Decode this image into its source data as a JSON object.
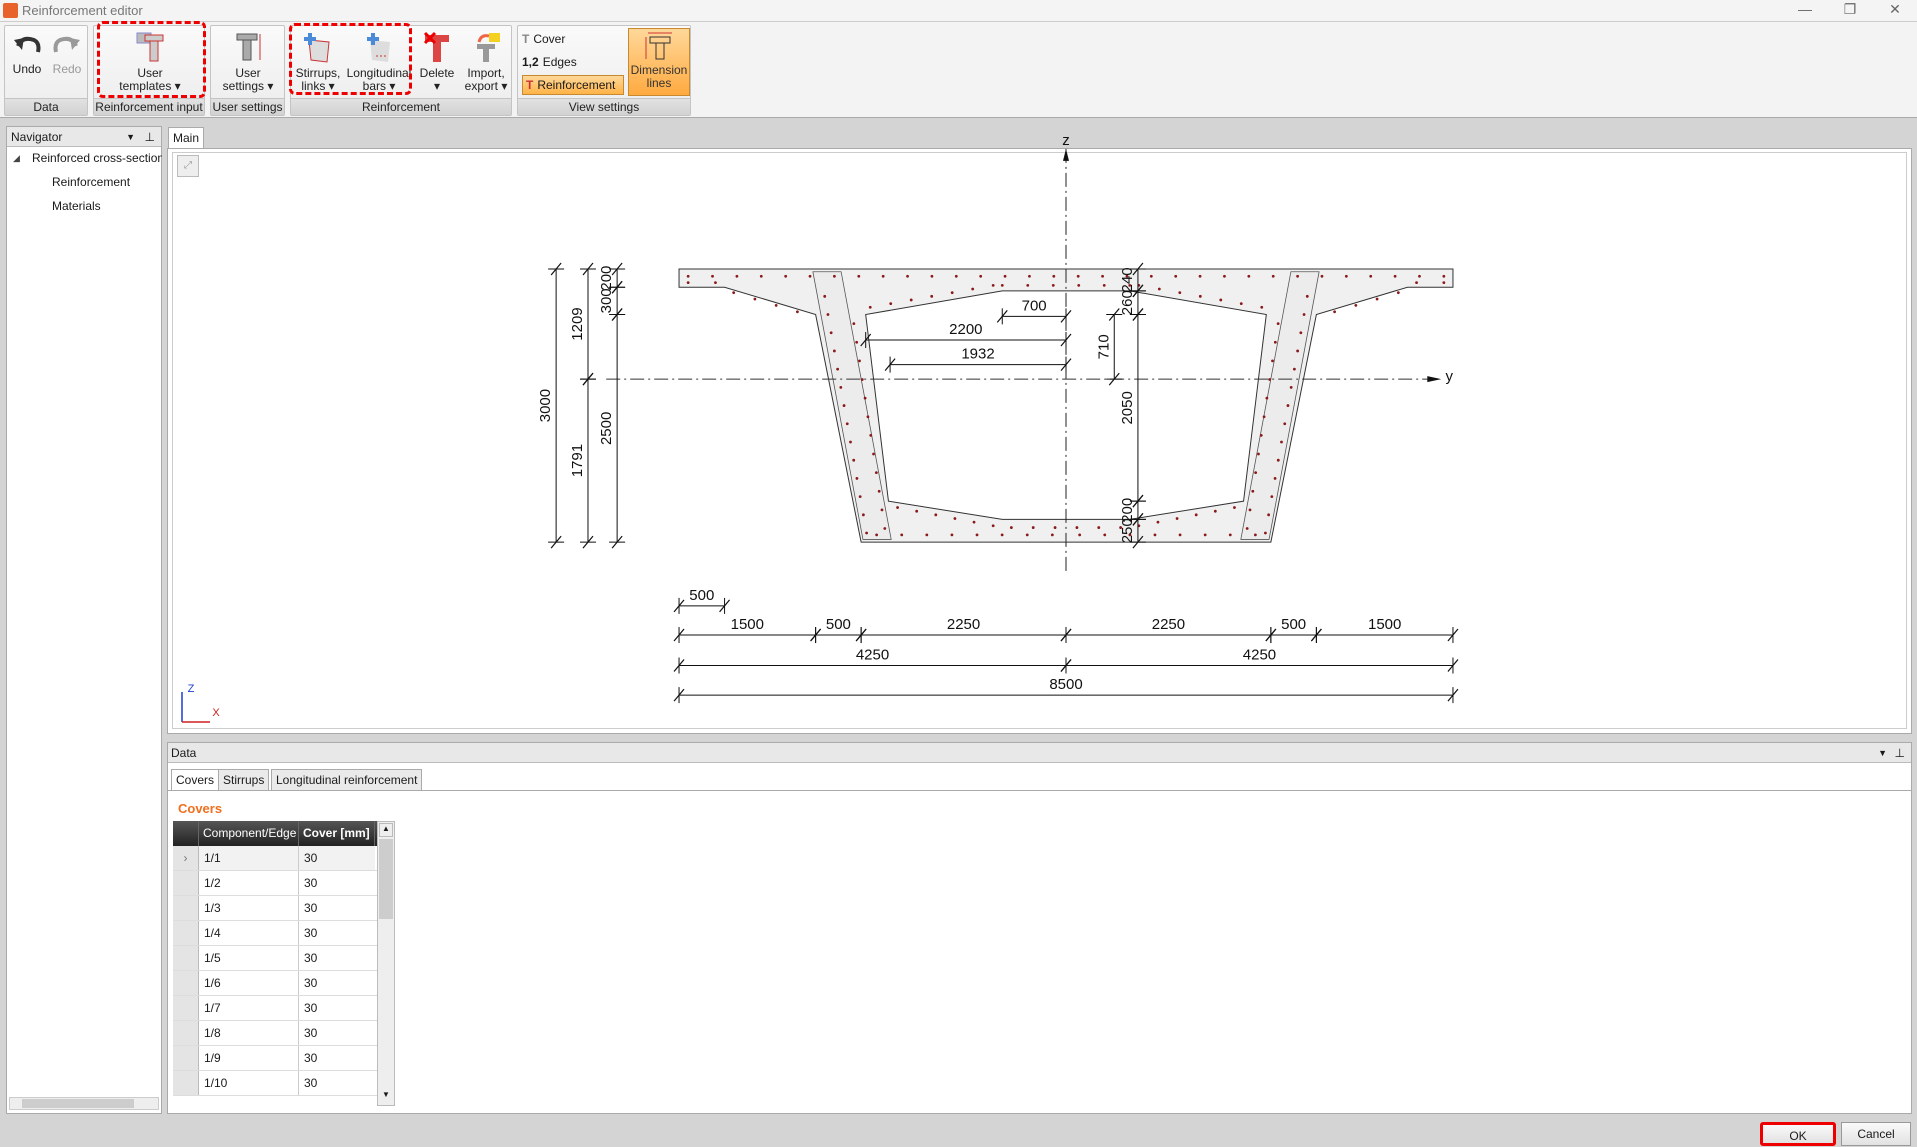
{
  "window": {
    "title": "Reinforcement editor",
    "minimize": "—",
    "restore": "❐",
    "close": "✕"
  },
  "ribbon": {
    "groups": [
      {
        "label": "Data",
        "buttons": [
          {
            "label": "Undo"
          },
          {
            "label": "Redo"
          }
        ]
      },
      {
        "label": "Reinforcement input",
        "buttons": [
          {
            "label": "User",
            "label2": "templates ▾"
          }
        ]
      },
      {
        "label": "User settings",
        "buttons": [
          {
            "label": "User",
            "label2": "settings ▾"
          }
        ]
      },
      {
        "label": "Reinforcement",
        "buttons": [
          {
            "label": "Stirrups,",
            "label2": "links ▾"
          },
          {
            "label": "Longitudinal",
            "label2": "bars ▾"
          },
          {
            "label": "Delete",
            "label2": "▾"
          },
          {
            "label": "Import,",
            "label2": "export ▾"
          }
        ]
      },
      {
        "label": "View settings",
        "items": [
          {
            "label": "Cover"
          },
          {
            "prefix": "1,2",
            "label": "Edges"
          },
          {
            "label": "Reinforcement"
          }
        ],
        "buttons": [
          {
            "label": "Dimension",
            "label2": "lines"
          }
        ]
      }
    ]
  },
  "navigator": {
    "title": "Navigator",
    "tree_root": "Reinforced cross-section",
    "children": [
      "Reinforcement",
      "Materials"
    ]
  },
  "main": {
    "tab": "Main",
    "axis_z": "z",
    "axis_y": "y",
    "mini_axis_z": "Z",
    "mini_axis_x": "X",
    "dimensions": {
      "v_total": "3000",
      "v_top": "1209",
      "v_bottom": "1791",
      "v_flange": "200",
      "v_haunch": "300",
      "v_web": "2500",
      "r_240": "240",
      "r_260": "260",
      "r_2050": "2050",
      "r_200": "200",
      "r_250": "250",
      "r_710": "710",
      "h_700": "700",
      "h_2200": "2200",
      "h_1932": "1932",
      "h_500": "500",
      "chain1": [
        "1500",
        "500",
        "2250",
        "2250",
        "500",
        "1500"
      ],
      "chain2": [
        "4250",
        "4250"
      ],
      "total": "8500"
    }
  },
  "data_panel": {
    "title": "Data",
    "tabs": [
      "Covers",
      "Stirrups",
      "Longitudinal reinforcement"
    ],
    "active_tab": "Covers",
    "section_title": "Covers",
    "columns": [
      "Component/Edge",
      "Cover [mm]"
    ],
    "rows": [
      {
        "edge": "1/1",
        "cover": "30"
      },
      {
        "edge": "1/2",
        "cover": "30"
      },
      {
        "edge": "1/3",
        "cover": "30"
      },
      {
        "edge": "1/4",
        "cover": "30"
      },
      {
        "edge": "1/5",
        "cover": "30"
      },
      {
        "edge": "1/6",
        "cover": "30"
      },
      {
        "edge": "1/7",
        "cover": "30"
      },
      {
        "edge": "1/8",
        "cover": "30"
      },
      {
        "edge": "1/9",
        "cover": "30"
      },
      {
        "edge": "1/10",
        "cover": "30"
      }
    ]
  },
  "footer": {
    "ok": "OK",
    "cancel": "Cancel"
  },
  "colors": {
    "accent": "#f07020",
    "rebar": "#8b1a1a",
    "highlight": "#e00000",
    "active_btn": "#ffb347"
  }
}
